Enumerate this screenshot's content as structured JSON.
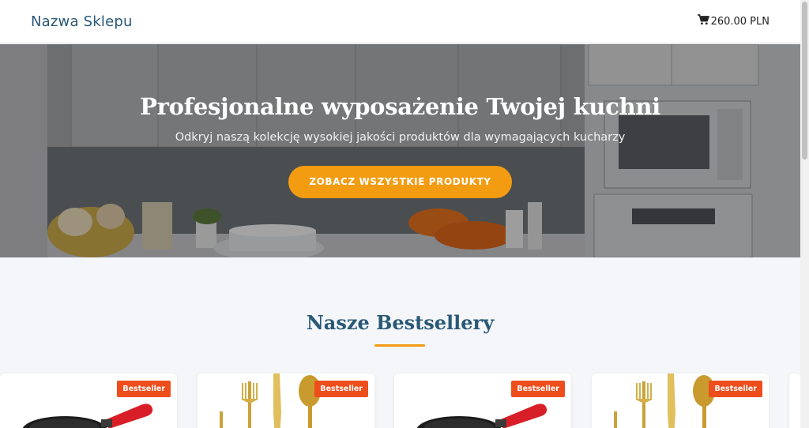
{
  "header": {
    "logo": "Nazwa Sklepu",
    "cart_total": "260.00 PLN",
    "cart_icon": "shopping-cart-icon"
  },
  "hero": {
    "title": "Profesjonalne wyposażenie Twojej kuchni",
    "subtitle": "Odkryj naszą kolekcję wysokiej jakości produktów dla wymagających kucharzy",
    "button": "ZOBACZ WSZYSTKIE PRODUKTY"
  },
  "bestsellers": {
    "title": "Nasze Bestsellery",
    "products": [
      {
        "badge": "Bestseller",
        "image": "frying-pan"
      },
      {
        "badge": "Bestseller",
        "image": "gold-cutlery"
      },
      {
        "badge": "Bestseller",
        "image": "frying-pan"
      },
      {
        "badge": "Bestseller",
        "image": "gold-cutlery"
      }
    ]
  },
  "colors": {
    "accent": "#f39c12",
    "brand": "#2a5877",
    "badge": "#ee4d1c"
  }
}
